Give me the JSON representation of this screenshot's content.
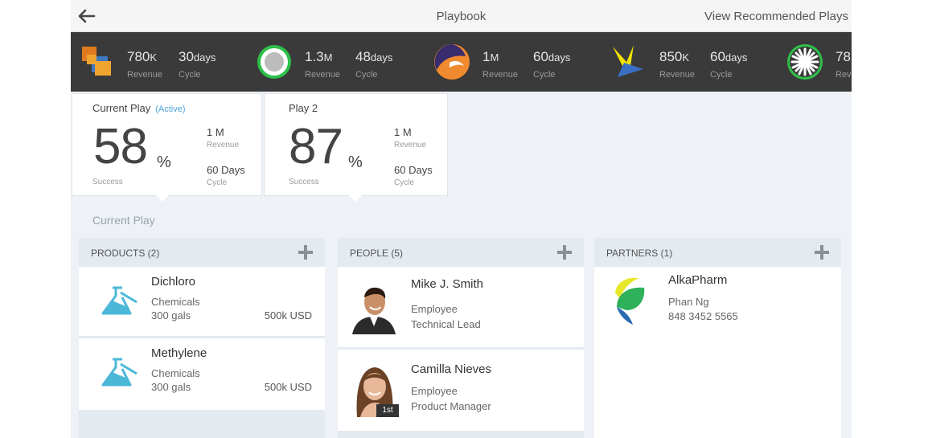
{
  "header": {
    "title": "Playbook",
    "action": "View Recommended Plays"
  },
  "stats": [
    {
      "value": "780",
      "unit": "K",
      "value_label": "Revenue",
      "cycle": "30",
      "cycle_unit": "days",
      "cycle_label": "Cycle",
      "icon": "orange-squares-logo"
    },
    {
      "value": "1.3",
      "unit": "M",
      "value_label": "Revenue",
      "cycle": "48",
      "cycle_unit": "days",
      "cycle_label": "Cycle",
      "icon": "green-ring-logo"
    },
    {
      "value": "1",
      "unit": "M",
      "value_label": "Revenue",
      "cycle": "60",
      "cycle_unit": "days",
      "cycle_label": "Cycle",
      "icon": "orange-swirl-logo"
    },
    {
      "value": "850",
      "unit": "K",
      "value_label": "Revenue",
      "cycle": "60",
      "cycle_unit": "days",
      "cycle_label": "Cycle",
      "icon": "yellow-y-logo"
    },
    {
      "value": "78",
      "value_label": "Rev",
      "icon": "green-starburst-logo"
    }
  ],
  "plays": [
    {
      "title": "Current Play",
      "status": "(Active)",
      "percent": "58",
      "percent_sign": "%",
      "percent_label": "Success",
      "revenue": "1 M",
      "revenue_label": "Revenue",
      "cycle": "60 Days",
      "cycle_label": "Cycle"
    },
    {
      "title": "Play 2",
      "percent": "87",
      "percent_sign": "%",
      "percent_label": "Success",
      "revenue": "1 M",
      "revenue_label": "Revenue",
      "cycle": "60 Days",
      "cycle_label": "Cycle"
    }
  ],
  "section_title": "Current Play",
  "products": {
    "title": "PRODUCTS (2)",
    "items": [
      {
        "name": "Dichloro",
        "category": "Chemicals",
        "quantity": "300 gals",
        "price": "500k USD",
        "icon": "flask-icon"
      },
      {
        "name": "Methylene",
        "category": "Chemicals",
        "quantity": "300 gals",
        "price": "500k USD",
        "icon": "flask-icon"
      }
    ]
  },
  "people": {
    "title": "PEOPLE (5)",
    "items": [
      {
        "name": "Mike J. Smith",
        "type": "Employee",
        "role": "Technical Lead"
      },
      {
        "name": "Camilla Nieves",
        "type": "Employee",
        "role": "Product Manager",
        "badge": "1st"
      }
    ]
  },
  "partners": {
    "title": "PARTNERS (1)",
    "items": [
      {
        "name": "AlkaPharm",
        "contact": "Phan Ng",
        "phone": "848 3452 5565"
      }
    ]
  },
  "colors": {
    "stats_bar": "#3a3a3a",
    "accent_blue": "#4da3d8",
    "flask": "#4bb8d8"
  }
}
